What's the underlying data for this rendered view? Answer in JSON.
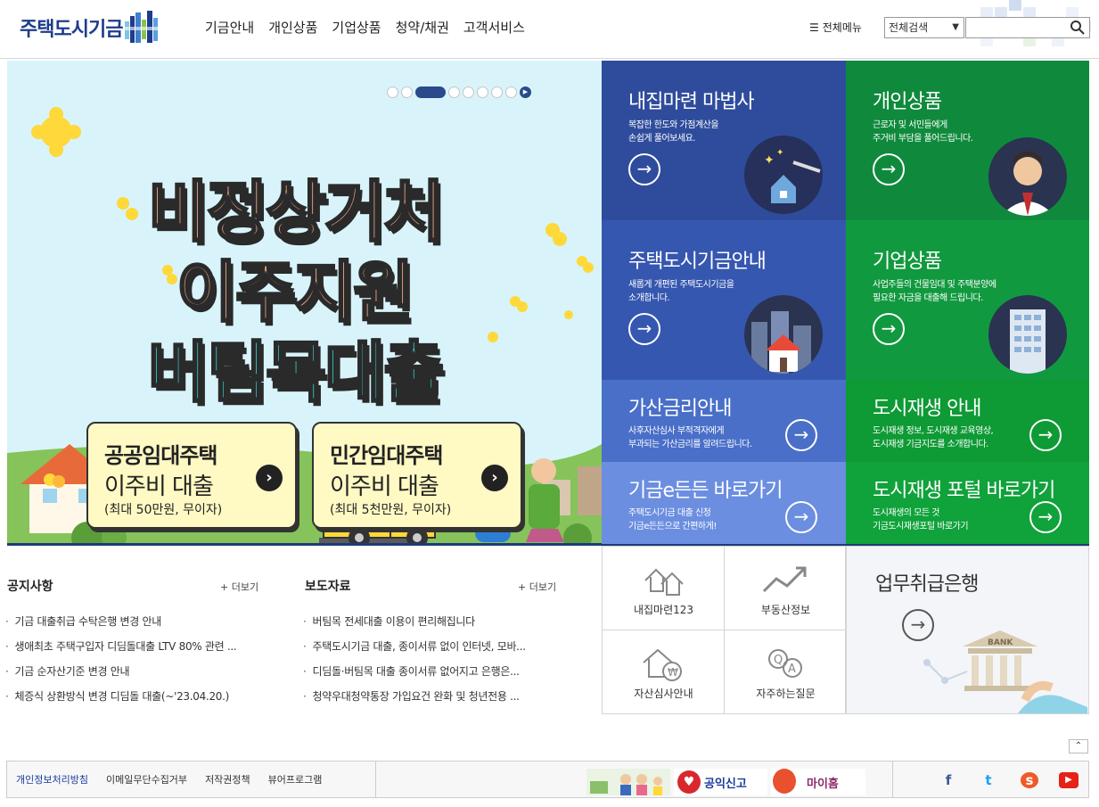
{
  "header": {
    "logo": "주택도시기금",
    "nav": [
      "기금안내",
      "개인상품",
      "기업상품",
      "청약/채권",
      "고객서비스"
    ],
    "all_menu": "전체메뉴",
    "search_select": "전체검색",
    "search_placeholder": ""
  },
  "banner": {
    "headline1": "비정상거처",
    "headline2": "이주지원",
    "headline3": "버팀목대출",
    "box1": {
      "line1": "공공임대주택",
      "line2": "이주비 대출",
      "line3": "(최대 50만원, 무이자)"
    },
    "box2": {
      "line1": "민간임대주택",
      "line2": "이주비 대출",
      "line3": "(최대 5천만원, 무이자)"
    },
    "slider_total": 8,
    "slider_active": 3
  },
  "tiles": [
    {
      "title": "내집마련 마법사",
      "desc1": "복잡한 한도와 가점계산을",
      "desc2": "손쉽게 풀어보세요.",
      "color": "#2f4c9c"
    },
    {
      "title": "개인상품",
      "desc1": "근로자 및 서민들에게",
      "desc2": "주거비 부담을 풀어드립니다.",
      "color": "#0f8a3c"
    },
    {
      "title": "주택도시기금안내",
      "desc1": "새롭게 개편된 주택도시기금을",
      "desc2": "소개합니다.",
      "color": "#3657b0"
    },
    {
      "title": "기업상품",
      "desc1": "사업주들의 건물임대 및 주택분양에",
      "desc2": "필요한 자금을 대출해 드립니다.",
      "color": "#11993f"
    },
    {
      "title": "가산금리안내",
      "desc1": "사후자산심사 부적격자에게",
      "desc2": "부과되는 가산금리를 알려드립니다.",
      "color": "#4a6fc8"
    },
    {
      "title": "도시재생 안내",
      "desc1": "도시재생 정보, 도시재생 교육영상,",
      "desc2": "도시재생 기금지도를 소개합니다.",
      "color": "#0e9a35"
    },
    {
      "title": "기금e든든 바로가기",
      "desc1": "주택도시기금 대출 신청",
      "desc2": "기금e든든으로 간편하게!",
      "color": "#6b8ee0"
    },
    {
      "title": "도시재생 포털 바로가기",
      "desc1": "도시재생의 모든 것",
      "desc2": "기금도시재생포털 바로가기",
      "color": "#10a23b"
    }
  ],
  "notice": {
    "title": "공지사항",
    "more": "+ 더보기",
    "items": [
      "기금 대출취급 수탁은행 변경 안내",
      "생애최초 주택구입자 디딤돌대출 LTV 80% 관련 ...",
      "기금 순자산기준 변경 안내",
      "체증식 상환방식 변경 디딤돌 대출(~'23.04.20.)"
    ]
  },
  "press": {
    "title": "보도자료",
    "more": "+ 더보기",
    "items": [
      "버팀목 전세대출 이용이 편리해집니다",
      "주택도시기금 대출, 종이서류 없이 인터넷, 모바...",
      "디딤돌·버팀목 대출 종이서류 없어지고 은행은...",
      "청약우대청약통장 가입요건 완화 및 청년전용 ..."
    ]
  },
  "quick": [
    "내집마련123",
    "부동산정보",
    "자산심사안내",
    "자주하는질문"
  ],
  "bank": {
    "title": "업무취급은행",
    "sign": "BANK"
  },
  "footer": {
    "links": [
      "개인정보처리방침",
      "이메일무단수집거부",
      "저작권정책",
      "뷰어프로그램"
    ],
    "banner2": "공익신고",
    "banner3": "마이홈",
    "sns": [
      "facebook-icon",
      "twitter-icon",
      "kakaostory-icon",
      "youtube-icon"
    ]
  }
}
